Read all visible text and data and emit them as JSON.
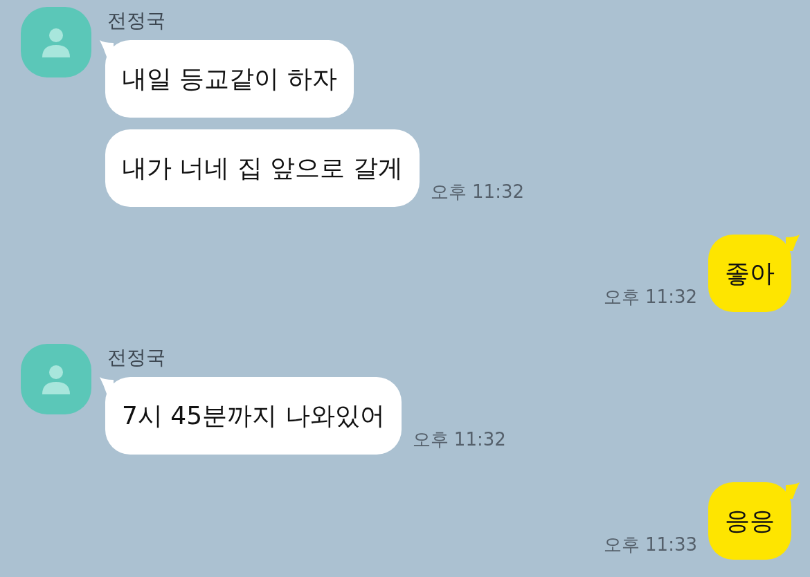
{
  "messages": [
    {
      "kind": "received",
      "sender": "전정국",
      "bubbles": [
        "내일 등교같이 하자",
        "내가 너네 집 앞으로 갈게"
      ],
      "time": "오후 11:32"
    },
    {
      "kind": "sent",
      "bubbles": [
        "좋아"
      ],
      "time": "오후 11:32"
    },
    {
      "kind": "received",
      "sender": "전정국",
      "bubbles": [
        "7시 45분까지 나와있어"
      ],
      "time": "오후 11:32"
    },
    {
      "kind": "sent",
      "bubbles": [
        "응응"
      ],
      "time": "오후 11:33"
    }
  ]
}
